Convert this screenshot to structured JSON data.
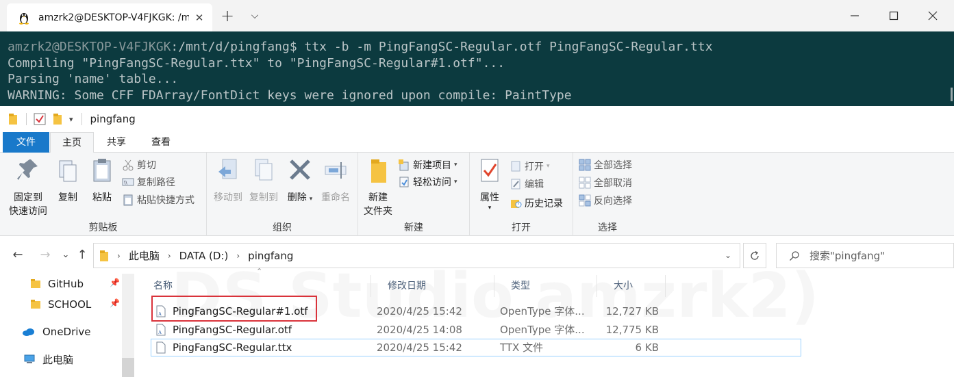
{
  "terminal": {
    "tab_title": "amzrk2@DESKTOP-V4FJKGK: /m",
    "tab_close": "✕",
    "new_tab": "+",
    "dropdown": "⌵",
    "prompt_user": "amzrk2@DESKTOP-V4FJKGK",
    "prompt_path": ":/mnt/d/pingfang$ ",
    "command": "ttx -b -m PingFangSC-Regular.otf PingFangSC-Regular.ttx",
    "output": [
      "Compiling \"PingFangSC-Regular.ttx\" to \"PingFangSC-Regular#1.otf\"...",
      "Parsing 'name' table...",
      "WARNING: Some CFF FDArray/FontDict keys were ignored upon compile: PaintType"
    ]
  },
  "explorer": {
    "window_title": "pingfang",
    "qat_caret": "▾",
    "tabs": [
      {
        "label": "文件"
      },
      {
        "label": "主页"
      },
      {
        "label": "共享"
      },
      {
        "label": "查看"
      }
    ],
    "ribbon": {
      "clipboard": {
        "label": "剪贴板",
        "pin_line1": "固定到",
        "pin_line2": "快速访问",
        "copy": "复制",
        "paste": "粘贴",
        "cut": "剪切",
        "copy_path": "复制路径",
        "paste_shortcut": "粘贴快捷方式"
      },
      "organize": {
        "label": "组织",
        "move_to": "移动到",
        "copy_to": "复制到",
        "delete": "删除",
        "rename": "重命名"
      },
      "new": {
        "label": "新建",
        "new_folder_line1": "新建",
        "new_folder_line2": "文件夹",
        "new_item": "新建项目",
        "easy_access": "轻松访问"
      },
      "open": {
        "label": "打开",
        "properties": "属性",
        "open": "打开",
        "edit": "编辑",
        "history": "历史记录"
      },
      "select": {
        "label": "选择",
        "select_all": "全部选择",
        "select_none": "全部取消",
        "invert": "反向选择"
      }
    },
    "nav": {
      "back": "←",
      "forward": "→",
      "recent": "⌄",
      "up": "↑"
    },
    "address": {
      "crumbs": [
        "此电脑",
        "DATA (D:)",
        "pingfang"
      ],
      "separator": "›",
      "dropdown": "⌄"
    },
    "search": {
      "placeholder": "搜索\"pingfang\""
    },
    "sidebar": {
      "items": [
        {
          "label": "GitHub"
        },
        {
          "label": "SCHOOL"
        },
        {
          "label": "OneDrive"
        },
        {
          "label": "此电脑"
        }
      ]
    },
    "columns": {
      "name": "名称",
      "date": "修改日期",
      "type": "类型",
      "size": "大小"
    },
    "files": [
      {
        "name": "PingFangSC-Regular#1.otf",
        "date": "2020/4/25 15:42",
        "type": "OpenType 字体...",
        "size": "12,727 KB"
      },
      {
        "name": "PingFangSC-Regular.otf",
        "date": "2020/4/25 14:08",
        "type": "OpenType 字体...",
        "size": "12,775 KB"
      },
      {
        "name": "PingFangSC-Regular.ttx",
        "date": "2020/4/25 15:42",
        "type": "TTX 文件",
        "size": "6 KB"
      }
    ]
  },
  "colors": {
    "terminal_bg": "#0c3a3f",
    "file_tab": "#1979ca",
    "highlight": "#d9323a",
    "folder": "#f5c342"
  }
}
